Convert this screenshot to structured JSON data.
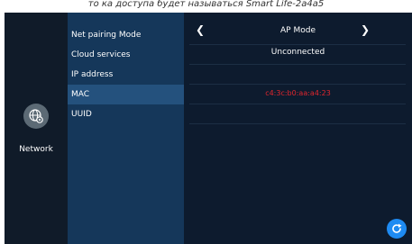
{
  "caption": "то ка доступа будет называться Smart Life-2a4a5",
  "sidebar": {
    "network_label": "Network",
    "network_icon": "network-settings-icon"
  },
  "menu": {
    "items": [
      {
        "label": "Net pairing Mode"
      },
      {
        "label": "Cloud services"
      },
      {
        "label": "IP address"
      },
      {
        "label": "MAC"
      },
      {
        "label": "UUID"
      }
    ],
    "active_index": 3
  },
  "settings": {
    "pairing_mode": "AP Mode",
    "cloud_status": "Unconnected",
    "ip_address": "",
    "mac": "c4:3c:b0:aa:a4:23",
    "uuid": ""
  },
  "colors": {
    "accent_red": "#e0262d",
    "refresh_blue": "#1e8bf2",
    "menu_bg": "#15375a",
    "menu_active": "#24517d"
  }
}
